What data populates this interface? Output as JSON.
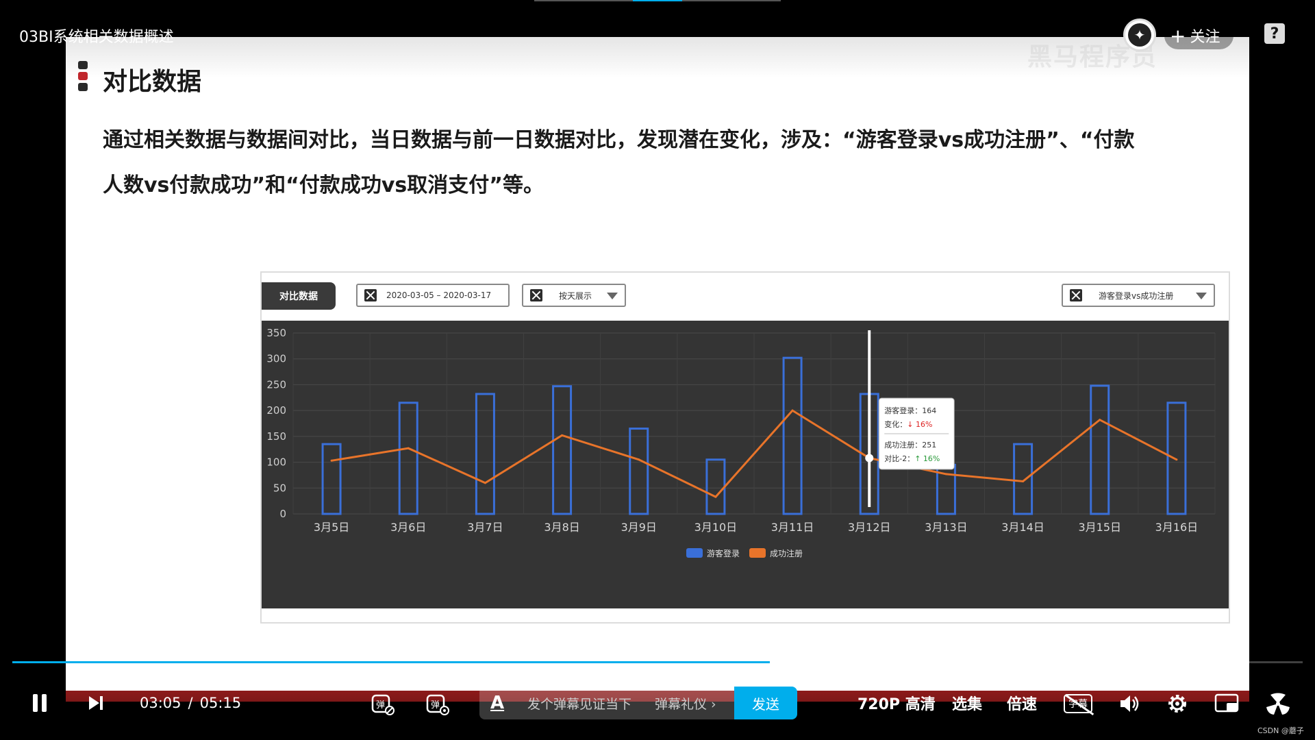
{
  "video": {
    "title": "03BI系统相关数据概述",
    "follow_label": "关注",
    "watermark": "黑马程序员",
    "help_label": "?"
  },
  "slide": {
    "title": "对比数据",
    "body_line1": "通过相关数据与数据间对比，当日数据与前一日数据对比，发现潜在变化，涉及：“游客登录vs成功注册”、“付款",
    "body_line2": "人数vs付款成功”和“付款成功vs取消支付”等。",
    "marker_colors": [
      "#2a2a2a",
      "#c0262c",
      "#2a2a2a"
    ]
  },
  "dashboard": {
    "tab_label": "对比数据",
    "date_range": "2020-03-05 – 2020-03-17",
    "group_select": "按天展示",
    "compare_select": "游客登录vs成功注册",
    "tooltip": {
      "line1": "游客登录：164",
      "line2_label": "变化：",
      "line2_value": "↓ 16%",
      "line3": "成功注册：251",
      "line4_label": "对比-2：",
      "line4_value": "↑ 16%"
    }
  },
  "chart_data": {
    "type": "bar",
    "categories": [
      "3月5日",
      "3月6日",
      "3月7日",
      "3月8日",
      "3月9日",
      "3月10日",
      "3月11日",
      "3月12日",
      "3月13日",
      "3月14日",
      "3月15日",
      "3月16日"
    ],
    "series": [
      {
        "name": "游客登录",
        "type": "bar",
        "color": "#3a6fd8",
        "values": [
          135,
          215,
          232,
          247,
          165,
          105,
          302,
          232,
          95,
          135,
          248,
          215
        ]
      },
      {
        "name": "成功注册",
        "type": "line",
        "color": "#e8742a",
        "values": [
          103,
          127,
          60,
          152,
          105,
          33,
          200,
          108,
          77,
          63,
          182,
          105
        ]
      }
    ],
    "ylim": [
      0,
      350
    ],
    "yticks": [
      0,
      50,
      100,
      150,
      200,
      250,
      300,
      350
    ],
    "highlight_index": 7,
    "grid": true,
    "legend_position": "bottom-center"
  },
  "player": {
    "current_time": "03:05",
    "separator": "/",
    "duration": "05:15",
    "progress": 0.587,
    "danmaku_placeholder": "发个弹幕见证当下",
    "danmaku_gift": "弹幕礼仪 ›",
    "send_label": "发送",
    "quality": "720P 高清",
    "episodes": "选集",
    "speed": "倍速",
    "subtitle_label": "字幕",
    "accent": "#00aeec"
  },
  "credit": "CSDN @蘑子"
}
